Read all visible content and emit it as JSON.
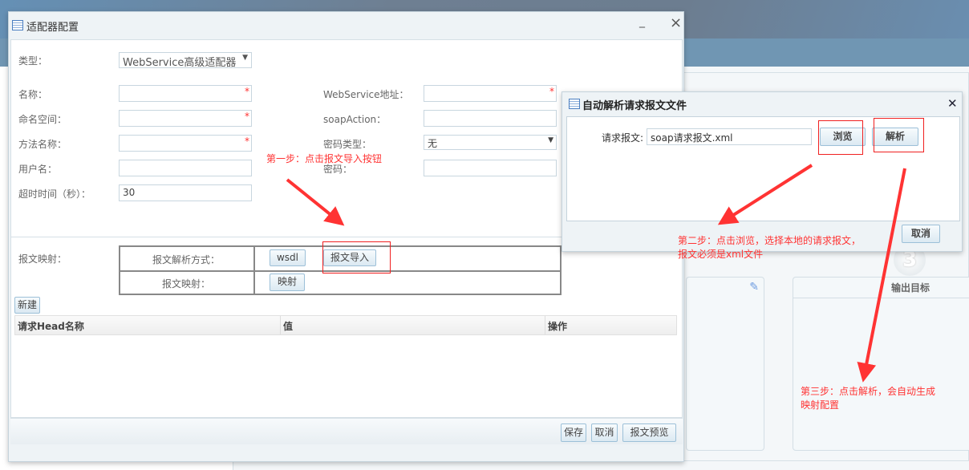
{
  "main_dialog": {
    "title": "适配器配置",
    "minimize": "_",
    "close": "×",
    "fields": {
      "type_label": "类型：",
      "type_value": "WebService高级适配器",
      "name_label": "名称：",
      "namespace_label": "命名空间：",
      "method_label": "方法名称：",
      "user_label": "用户名：",
      "timeout_label": "超时时间（秒）：",
      "timeout_value": "30",
      "ws_addr_label": "WebService地址：",
      "soap_action_label": "soapAction：",
      "pwd_type_label": "密码类型：",
      "pwd_type_value": "无",
      "pwd_label": "密码：",
      "required_mark": "*"
    },
    "mapping": {
      "label": "报文映射：",
      "parse_method_label": "报文解析方式：",
      "wsdl_btn": "wsdl",
      "import_btn": "报文导入",
      "map_label": "报文映射：",
      "map_btn": "映射"
    },
    "new_btn": "新建",
    "grid": {
      "columns": [
        "请求Head名称",
        "值",
        "操作"
      ]
    },
    "footer": {
      "save": "保存",
      "cancel": "取消",
      "preview": "报文预览"
    }
  },
  "parse_dialog": {
    "title": "自动解析请求报文文件",
    "close": "✕",
    "file_label": "请求报文:",
    "file_value": "soap请求报文.xml",
    "browse_btn": "浏览",
    "parse_btn": "解析",
    "cancel_btn": "取消"
  },
  "background": {
    "step_number": "3",
    "output_target": "输出目标"
  },
  "annotations": {
    "step1": "第一步：点击报文导入按钮",
    "step2_line1": "第二步：点击浏览，选择本地的请求报文，",
    "step2_line2": "报文必须是xml文件",
    "step3_line1": "第三步：点击解析，会自动生成",
    "step3_line2": "映射配置"
  },
  "colors": {
    "annotation": "#f33333",
    "header": "#6c7f93"
  }
}
